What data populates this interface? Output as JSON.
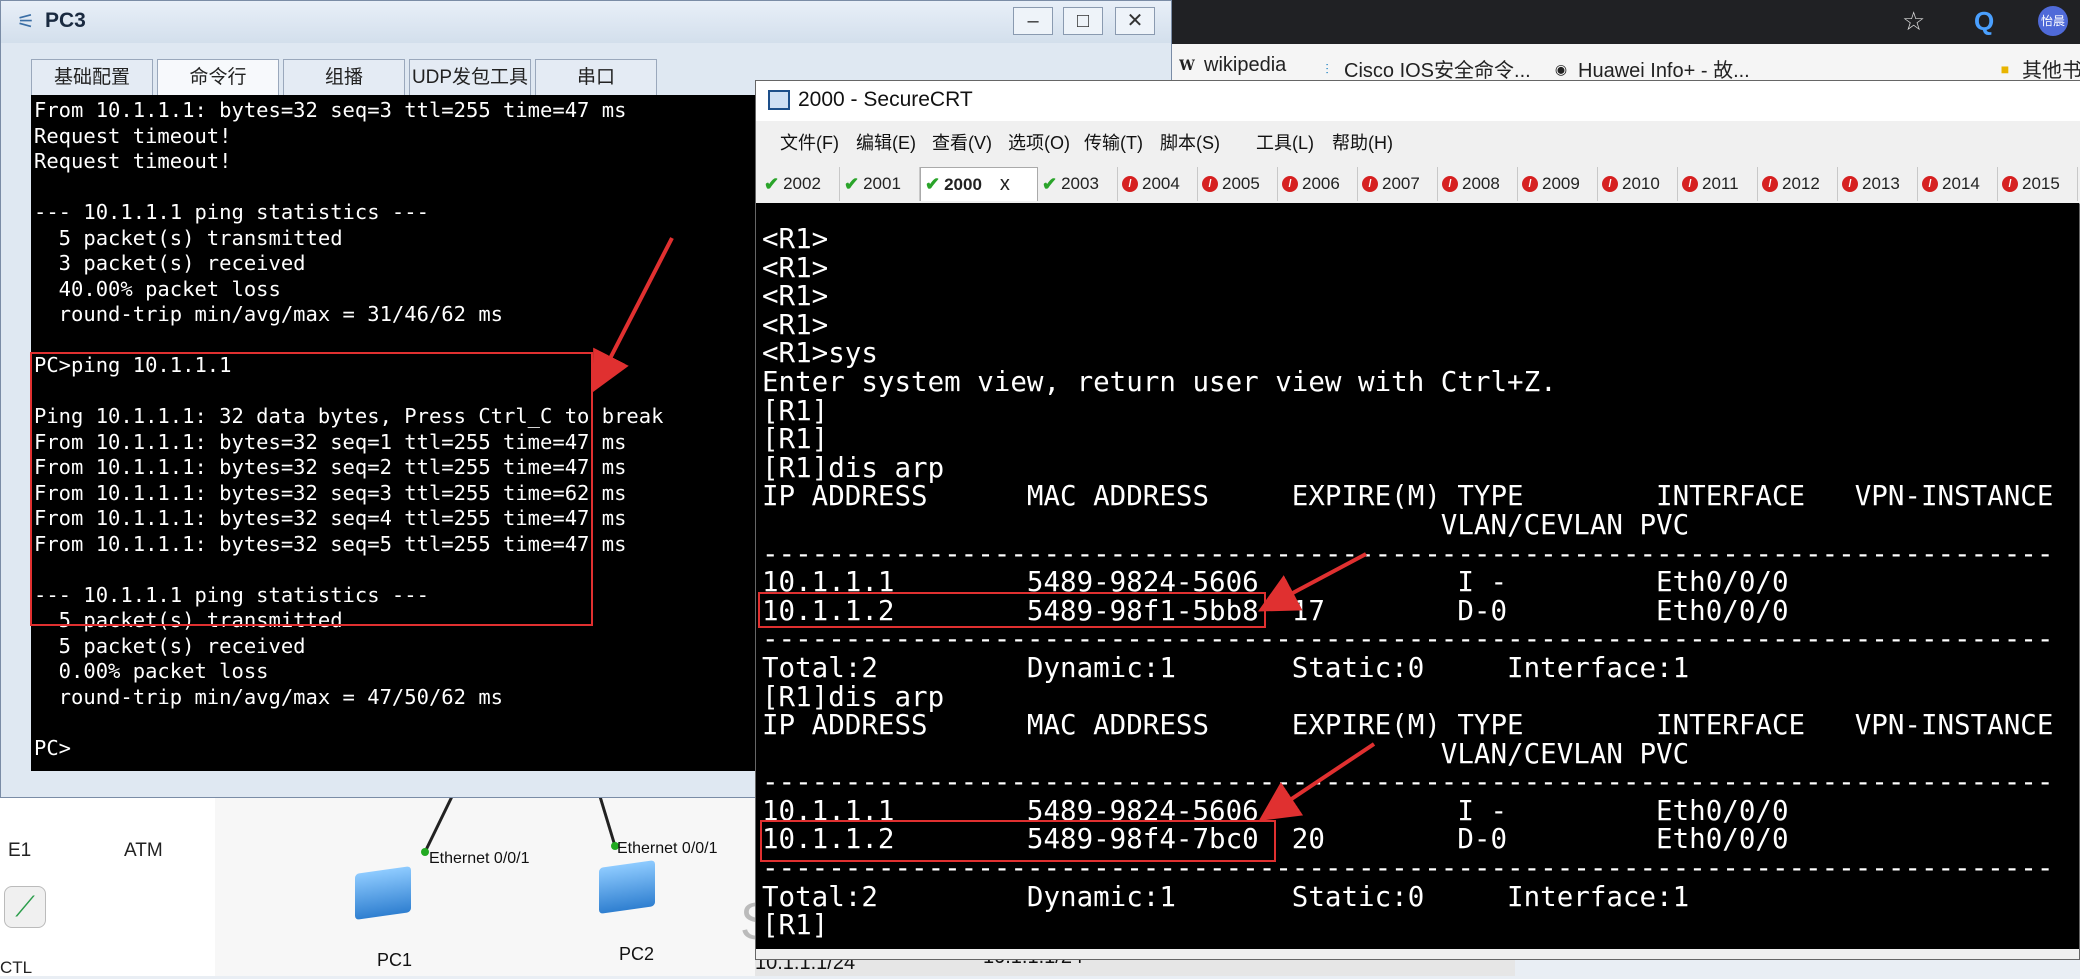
{
  "browser": {
    "bookmarks": [
      {
        "icon": "wikipedia-icon",
        "label": "wikipedia"
      },
      {
        "icon": "cisco-icon",
        "label": "Cisco IOS安全命令..."
      },
      {
        "icon": "globe-icon",
        "label": "Huawei Info+ - 故..."
      },
      {
        "icon": "folder-icon",
        "label": "其他书"
      }
    ],
    "avatar_label": "怡晨"
  },
  "ensp": {
    "devices": [
      {
        "label": "E1"
      },
      {
        "label": "ATM"
      },
      {
        "label": "CTL"
      },
      {
        "label": "PC1",
        "port": "Ethernet 0/0/1"
      },
      {
        "label": "PC2",
        "port": "Ethernet 0/0/1"
      }
    ],
    "partial_label_1": "10.1.1.1/24",
    "partial_label_2": "10.1.1.1/24",
    "partial_label_3": "S"
  },
  "pc3": {
    "title": "PC3",
    "tabs": [
      "基础配置",
      "命令行",
      "组播",
      "UDP发包工具",
      "串口"
    ],
    "active_tab": "命令行",
    "terminal_lines": [
      "From 10.1.1.1: bytes=32 seq=3 ttl=255 time=47 ms",
      "Request timeout!",
      "Request timeout!",
      "",
      "--- 10.1.1.1 ping statistics ---",
      "  5 packet(s) transmitted",
      "  3 packet(s) received",
      "  40.00% packet loss",
      "  round-trip min/avg/max = 31/46/62 ms",
      "",
      "PC>ping 10.1.1.1",
      "",
      "Ping 10.1.1.1: 32 data bytes, Press Ctrl_C to break",
      "From 10.1.1.1: bytes=32 seq=1 ttl=255 time=47 ms",
      "From 10.1.1.1: bytes=32 seq=2 ttl=255 time=47 ms",
      "From 10.1.1.1: bytes=32 seq=3 ttl=255 time=62 ms",
      "From 10.1.1.1: bytes=32 seq=4 ttl=255 time=47 ms",
      "From 10.1.1.1: bytes=32 seq=5 ttl=255 time=47 ms",
      "",
      "--- 10.1.1.1 ping statistics ---",
      "  5 packet(s) transmitted",
      "  5 packet(s) received",
      "  0.00% packet loss",
      "  round-trip min/avg/max = 47/50/62 ms",
      "",
      "PC>"
    ]
  },
  "crt": {
    "title": "2000 - SecureCRT",
    "menu": [
      "文件(F)",
      "编辑(E)",
      "查看(V)",
      "选项(O)",
      "传输(T)",
      "脚本(S)",
      "工具(L)",
      "帮助(H)"
    ],
    "tabs": [
      {
        "label": "2002",
        "status": "ok"
      },
      {
        "label": "2001",
        "status": "ok"
      },
      {
        "label": "2000",
        "status": "ok"
      },
      {
        "label": "2003",
        "status": "ok"
      },
      {
        "label": "2004",
        "status": "err"
      },
      {
        "label": "2005",
        "status": "err"
      },
      {
        "label": "2006",
        "status": "err"
      },
      {
        "label": "2007",
        "status": "err"
      },
      {
        "label": "2008",
        "status": "err"
      },
      {
        "label": "2009",
        "status": "err"
      },
      {
        "label": "2010",
        "status": "err"
      },
      {
        "label": "2011",
        "status": "err"
      },
      {
        "label": "2012",
        "status": "err"
      },
      {
        "label": "2013",
        "status": "err"
      },
      {
        "label": "2014",
        "status": "err"
      },
      {
        "label": "2015",
        "status": "err"
      }
    ],
    "active_tab": "2000",
    "tab_close": "x",
    "terminal_lines": [
      "<R1>",
      "<R1>",
      "<R1>",
      "<R1>",
      "<R1>sys",
      "Enter system view, return user view with Ctrl+Z.",
      "[R1]",
      "[R1]",
      "[R1]dis arp",
      "IP ADDRESS      MAC ADDRESS     EXPIRE(M) TYPE        INTERFACE   VPN-INSTANCE",
      "                                         VLAN/CEVLAN PVC",
      "------------------------------------------------------------------------------",
      "10.1.1.1        5489-9824-5606            I -         Eth0/0/0",
      "10.1.1.2        5489-98f1-5bb8  17        D-0         Eth0/0/0",
      "------------------------------------------------------------------------------",
      "Total:2         Dynamic:1       Static:0     Interface:1",
      "[R1]dis arp",
      "IP ADDRESS      MAC ADDRESS     EXPIRE(M) TYPE        INTERFACE   VPN-INSTANCE",
      "                                         VLAN/CEVLAN PVC",
      "------------------------------------------------------------------------------",
      "10.1.1.1        5489-9824-5606            I -         Eth0/0/0",
      "10.1.1.2        5489-98f4-7bc0  20        D-0         Eth0/0/0",
      "------------------------------------------------------------------------------",
      "Total:2         Dynamic:1       Static:0     Interface:1",
      "[R1]"
    ]
  },
  "colors": {
    "highlight": "#e03030",
    "ok": "#2aa42a",
    "err": "#d62020"
  }
}
